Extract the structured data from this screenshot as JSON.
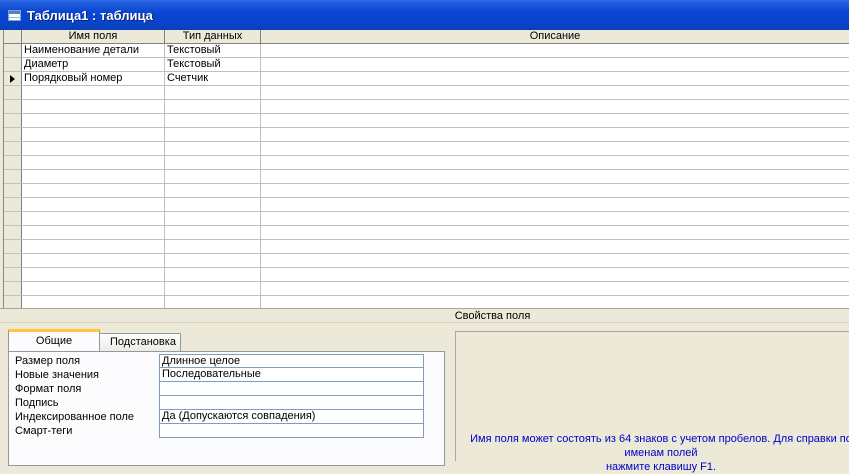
{
  "window": {
    "title": "Таблица1 : таблица"
  },
  "grid": {
    "columns": [
      "Имя поля",
      "Тип данных",
      "Описание"
    ],
    "rows": [
      {
        "name": "Наименование детали",
        "type": "Текстовый",
        "description": ""
      },
      {
        "name": "Диаметр",
        "type": "Текстовый",
        "description": ""
      },
      {
        "name": "Порядковый номер",
        "type": "Счетчик",
        "description": ""
      }
    ],
    "current_row": 3
  },
  "properties": {
    "title": "Свойства поля",
    "tabs": [
      "Общие",
      "Подстановка"
    ],
    "active_tab": "Общие",
    "rows": [
      {
        "label": "Размер поля",
        "value": "Длинное целое"
      },
      {
        "label": "Новые значения",
        "value": "Последовательные"
      },
      {
        "label": "Формат поля",
        "value": ""
      },
      {
        "label": "Подпись",
        "value": ""
      },
      {
        "label": "Индексированное поле",
        "value": "Да (Допускаются совпадения)"
      },
      {
        "label": "Смарт-теги",
        "value": ""
      }
    ],
    "help_line1": "Имя поля может состоять из 64 знаков с учетом пробелов.  Для справки по именам полей",
    "help_line2": "нажмите клавишу F1."
  }
}
